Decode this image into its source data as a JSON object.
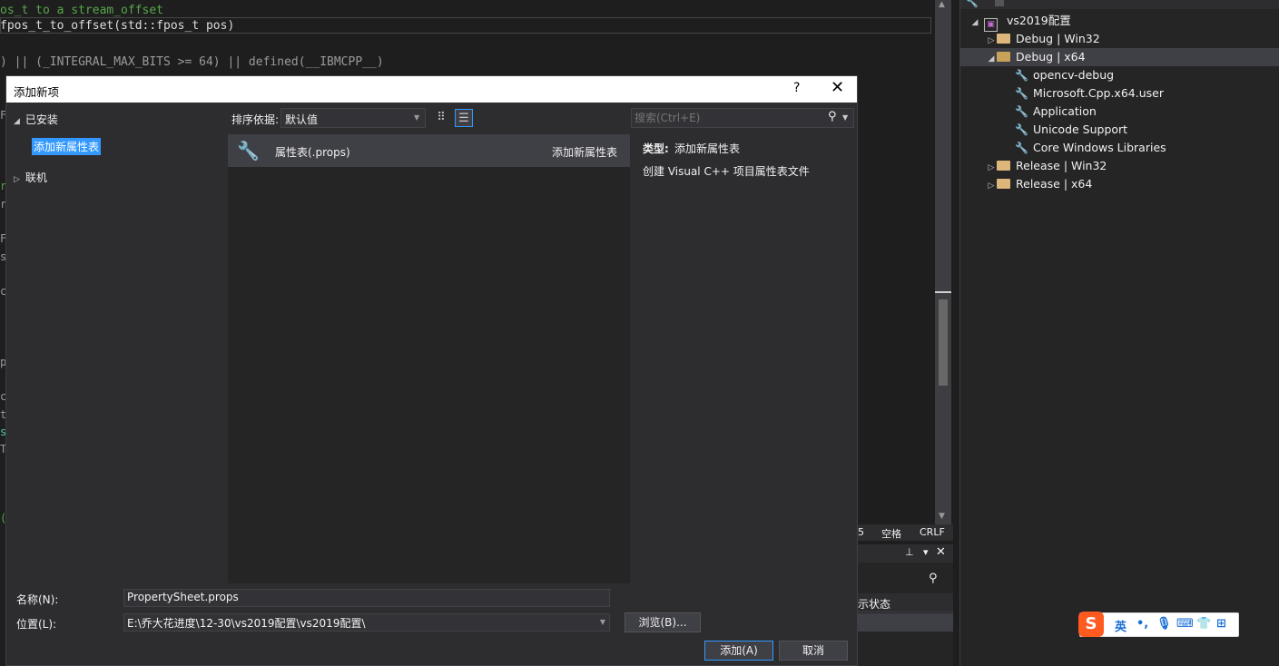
{
  "editor": {
    "lines": [
      {
        "text": "os_t to a stream_offset",
        "kind": "comment"
      },
      {
        "text": "fpos_t_to_offset(std::fpos_t pos)",
        "kind": "code"
      },
      {
        "text": ") || (_INTEGRAL_MAX_BITS >= 64) || defined(__IBMCPP__)",
        "kind": "code"
      }
    ],
    "gutter": [
      "F",
      "r",
      "r",
      "F",
      "s",
      "c",
      "p",
      "c",
      "t",
      "s",
      "T",
      "("
    ]
  },
  "status_bar": {
    "col": "5",
    "indent": "空格",
    "eol": "CRLF"
  },
  "lower_pane": {
    "column_header": "示状态"
  },
  "solution_explorer": {
    "project": "vs2019配置",
    "nodes": [
      {
        "label": "Debug | Win32",
        "type": "folder",
        "expanded": false,
        "level": 1
      },
      {
        "label": "Debug | x64",
        "type": "folder",
        "expanded": true,
        "level": 1,
        "selected": true
      },
      {
        "label": "opencv-debug",
        "type": "sheet",
        "level": 2
      },
      {
        "label": "Microsoft.Cpp.x64.user",
        "type": "sheet",
        "level": 2
      },
      {
        "label": "Application",
        "type": "sheet",
        "level": 2
      },
      {
        "label": "Unicode Support",
        "type": "sheet",
        "level": 2
      },
      {
        "label": "Core Windows Libraries",
        "type": "sheet",
        "level": 2
      },
      {
        "label": "Release | Win32",
        "type": "folder",
        "expanded": false,
        "level": 1
      },
      {
        "label": "Release | x64",
        "type": "folder",
        "expanded": false,
        "level": 1
      }
    ]
  },
  "dialog": {
    "title": "添加新项",
    "help": "?",
    "close": "✕",
    "left": {
      "installed": "已安装",
      "selected_category": "添加新属性表",
      "online": "联机"
    },
    "toolbar": {
      "sort_label": "排序依据:",
      "sort_value": "默认值",
      "search_placeholder": "搜索(Ctrl+E)"
    },
    "templates": [
      {
        "name": "属性表(.props)",
        "category": "添加新属性表"
      }
    ],
    "details": {
      "type_label": "类型:",
      "type_value": "添加新属性表",
      "description": "创建 Visual C++ 项目属性表文件"
    },
    "name_label": "名称(N):",
    "name_value": "PropertySheet.props",
    "location_label": "位置(L):",
    "location_value": "E:\\乔大花进度\\12-30\\vs2019配置\\vs2019配置\\",
    "browse_label": "浏览(B)...",
    "add_label": "添加(A)",
    "cancel_label": "取消"
  },
  "ime": {
    "logo": "S",
    "mode": "英",
    "punct": "•,",
    "icons": [
      "microphone-icon",
      "keyboard-icon",
      "shirt-icon",
      "apps-icon"
    ]
  }
}
